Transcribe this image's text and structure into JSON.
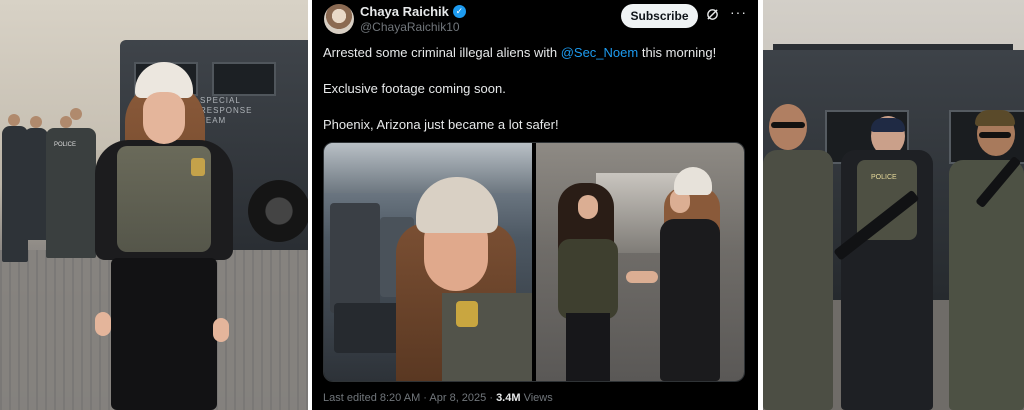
{
  "left_photo": {
    "truck_text": "SPECIAL RESPONSE TEAM",
    "vest_text": "POLICE"
  },
  "tweet": {
    "author": {
      "name": "Chaya Raichik",
      "handle": "@ChayaRaichik10",
      "verified_icon": "verified-badge-icon"
    },
    "subscribe_label": "Subscribe",
    "grok_icon": "grok-icon",
    "more_label": "···",
    "text": {
      "line1_before": "Arrested some criminal illegal aliens with ",
      "line1_mention": "@Sec_Noem",
      "line1_after": " this morning!",
      "line2": "Exclusive footage coming soon.",
      "line3": "Phoenix, Arizona just became a lot safer!"
    },
    "meta": {
      "edited": "Last edited 8:20 AM · Apr 8, 2025 · ",
      "views_count": "3.4M",
      "views_label": " Views"
    }
  },
  "right_photo": {
    "vest_text": "POLICE"
  },
  "colors": {
    "tweet_bg": "#000000",
    "link": "#1d9bf0",
    "verified": "#1d9bf0",
    "muted_text": "#71767b"
  }
}
